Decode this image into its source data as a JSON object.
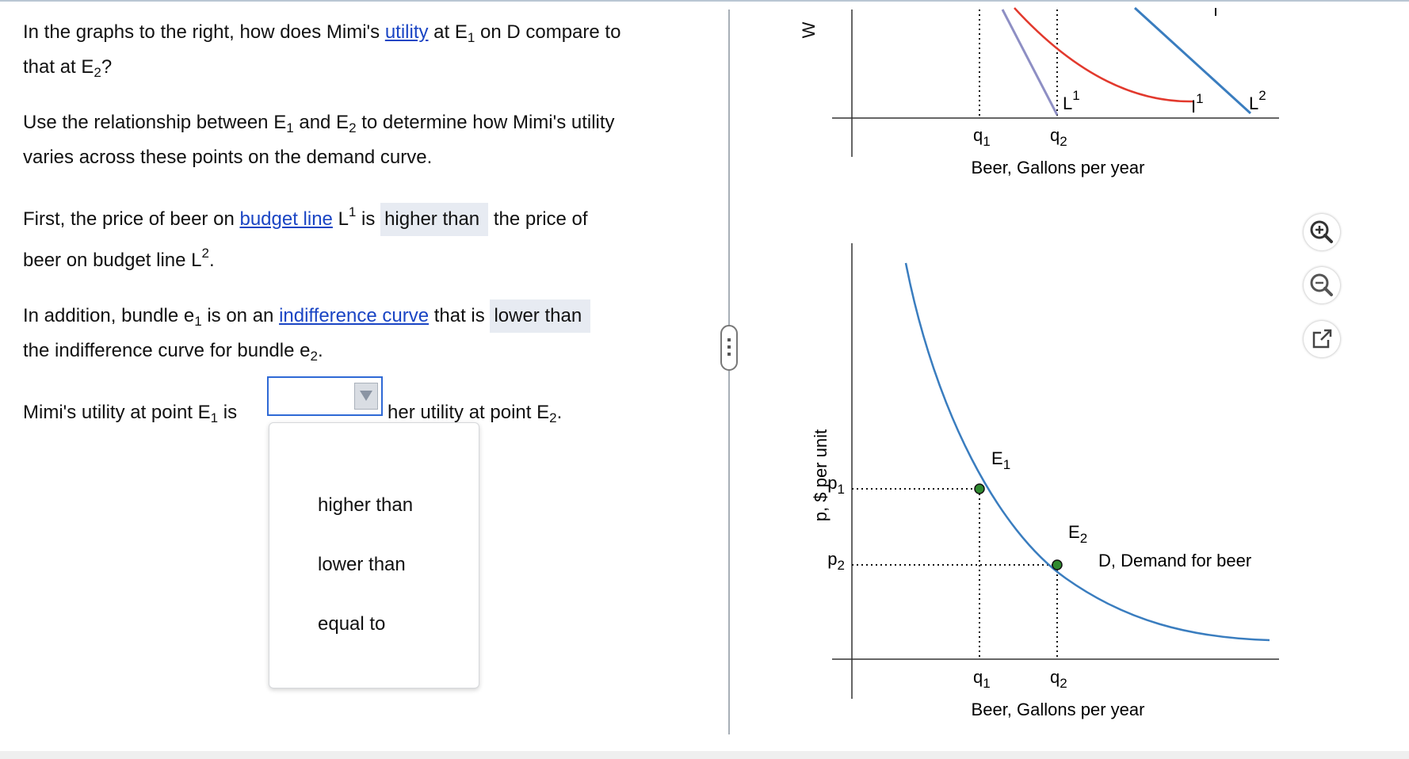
{
  "question": {
    "intro_a": "In the graphs to the right, how does Mimi's ",
    "utility_link": "utility",
    "intro_b": " at E",
    "intro_b_sub": "1",
    "intro_c": " on D compare to",
    "intro_d": "that at E",
    "intro_d_sub": "2",
    "intro_e": "?",
    "hint_a": "Use the relationship between E",
    "hint_a_sub": "1",
    "hint_b": " and E",
    "hint_b_sub": "2",
    "hint_c": " to determine how Mimi's utility",
    "hint_d": "varies across these points on the demand curve.",
    "step1_a": "First, the price of beer on ",
    "step1_link": "budget line",
    "step1_b": " L",
    "step1_b_sup": "1",
    "step1_c": " is ",
    "step1_answer": "higher than",
    "step1_d": " the price of",
    "step1_e": "beer on budget line L",
    "step1_e_sup": "2",
    "step1_f": ".",
    "step2_a": "In addition, bundle e",
    "step2_a_sub": "1",
    "step2_b": " is on an ",
    "step2_link": "indifference curve",
    "step2_c": " that is ",
    "step2_answer": "lower than",
    "step2_d": "the indifference curve for bundle e",
    "step2_d_sub": "2",
    "step2_e": ".",
    "final_a": "Mimi's utility at point E",
    "final_a_sub": "1",
    "final_b": " is",
    "final_c": "her utility at point E",
    "final_c_sub": "2",
    "final_d": "."
  },
  "dropdown": {
    "selected": "",
    "options": [
      "higher than",
      "lower than",
      "equal to"
    ]
  },
  "top_graph": {
    "ylabel_partial": "W",
    "xlabel": "Beer, Gallons per year",
    "q1": "q",
    "q1_sub": "1",
    "q2": "q",
    "q2_sub": "2",
    "L1": "L",
    "L1_sup": "1",
    "I1": "I",
    "I1_sup": "1",
    "L2": "L",
    "L2_sup": "2"
  },
  "bottom_graph": {
    "ylabel": "p, $ per unit",
    "xlabel": "Beer, Gallons per year",
    "p1": "p",
    "p1_sub": "1",
    "p2": "p",
    "p2_sub": "2",
    "q1": "q",
    "q1_sub": "1",
    "q2": "q",
    "q2_sub": "2",
    "E1": "E",
    "E1_sub": "1",
    "E2": "E",
    "E2_sub": "2",
    "demand_label": "D, Demand for beer"
  },
  "colors": {
    "link": "#1a45c4",
    "demand_curve": "#3a7dbf",
    "indifference_curve": "#e2392d",
    "budget_line_L1": "#8e8fc4",
    "budget_line_L2": "#3a7dbf",
    "point": "#2f8a2f",
    "answer_bg": "#e7ebf2"
  },
  "tools": {
    "zoom_in": "zoom-in-icon",
    "zoom_out": "zoom-out-icon",
    "popout": "popout-icon"
  }
}
